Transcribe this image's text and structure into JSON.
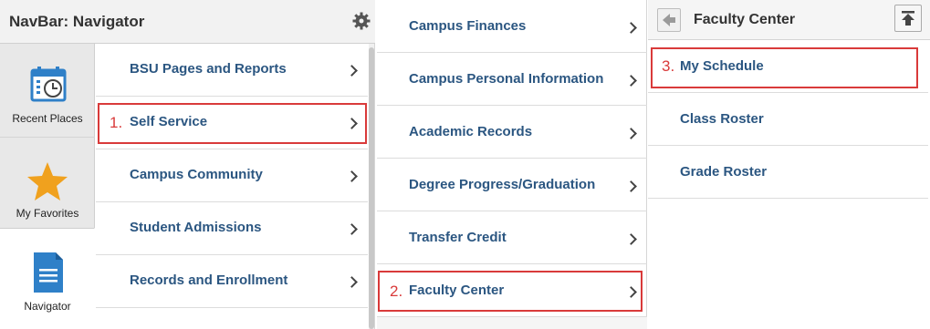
{
  "navbar": {
    "title": "NavBar: Navigator",
    "settings_icon": "gear-icon",
    "rail": [
      {
        "label": "Recent Places",
        "icon": "calendar-clock-icon"
      },
      {
        "label": "My Favorites",
        "icon": "star-icon"
      },
      {
        "label": "Navigator",
        "icon": "document-icon"
      }
    ],
    "items": [
      {
        "label": "BSU Pages and Reports"
      },
      {
        "label": "Self Service"
      },
      {
        "label": "Campus Community"
      },
      {
        "label": "Student Admissions"
      },
      {
        "label": "Records and Enrollment"
      }
    ]
  },
  "submenu": {
    "items": [
      {
        "label": "Campus Finances"
      },
      {
        "label": "Campus Personal Information"
      },
      {
        "label": "Academic Records"
      },
      {
        "label": "Degree Progress/Graduation"
      },
      {
        "label": "Transfer Credit"
      },
      {
        "label": "Faculty Center"
      }
    ]
  },
  "faculty_center": {
    "title": "Faculty Center",
    "back_icon": "back-arrow-icon",
    "top_icon": "move-to-top-icon",
    "items": [
      {
        "label": "My Schedule"
      },
      {
        "label": "Class Roster"
      },
      {
        "label": "Grade Roster"
      }
    ]
  },
  "annotations": [
    {
      "number": "1."
    },
    {
      "number": "2."
    },
    {
      "number": "3."
    }
  ],
  "colors": {
    "link": "#2b5681",
    "annotation": "#d93a3a",
    "accent_blue": "#2f80c8",
    "star": "#f0a11e"
  }
}
